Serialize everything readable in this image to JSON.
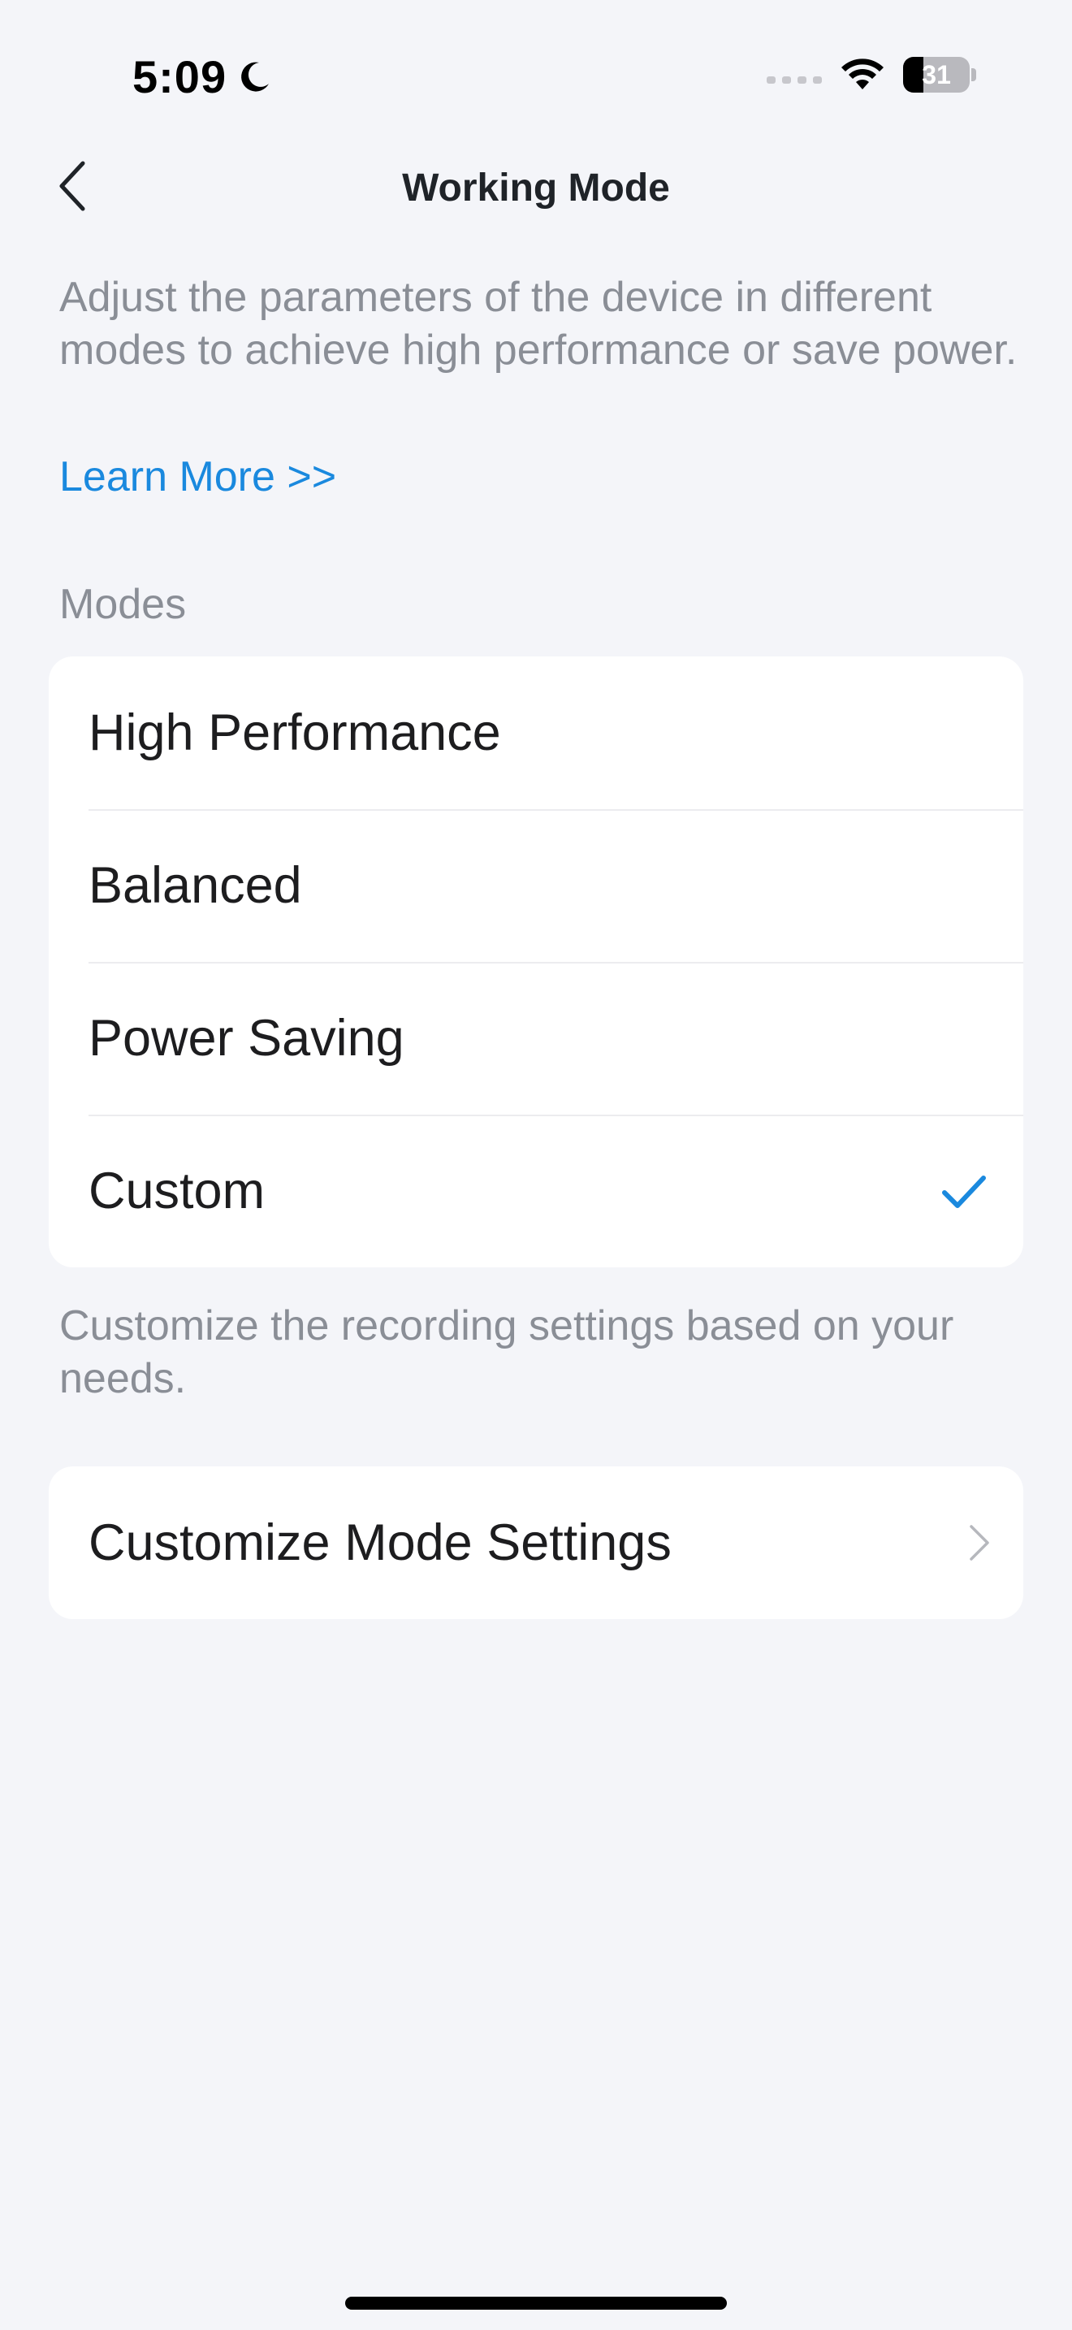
{
  "status_bar": {
    "time": "5:09",
    "battery_level": "31",
    "battery_fraction": 0.31
  },
  "nav": {
    "title": "Working Mode"
  },
  "description": "Adjust the parameters of the device in different modes to achieve high performance or save power.",
  "learn_more": "Learn More >>",
  "modes_section": {
    "header": "Modes",
    "items": [
      {
        "label": "High Performance",
        "selected": false
      },
      {
        "label": "Balanced",
        "selected": false
      },
      {
        "label": "Power Saving",
        "selected": false
      },
      {
        "label": "Custom",
        "selected": true
      }
    ]
  },
  "custom_note": "Customize the recording settings based on your needs.",
  "customize_settings": {
    "label": "Customize Mode Settings"
  },
  "colors": {
    "accent": "#1a89de",
    "background": "#f4f5f9",
    "secondary_text": "#8a8e96",
    "card": "#ffffff"
  },
  "icons": {
    "back": "chevron-left-icon",
    "selected": "check-icon",
    "disclosure": "chevron-right-icon",
    "dnd": "moon-icon",
    "wifi": "wifi-icon",
    "cellular": "signal-icon"
  }
}
